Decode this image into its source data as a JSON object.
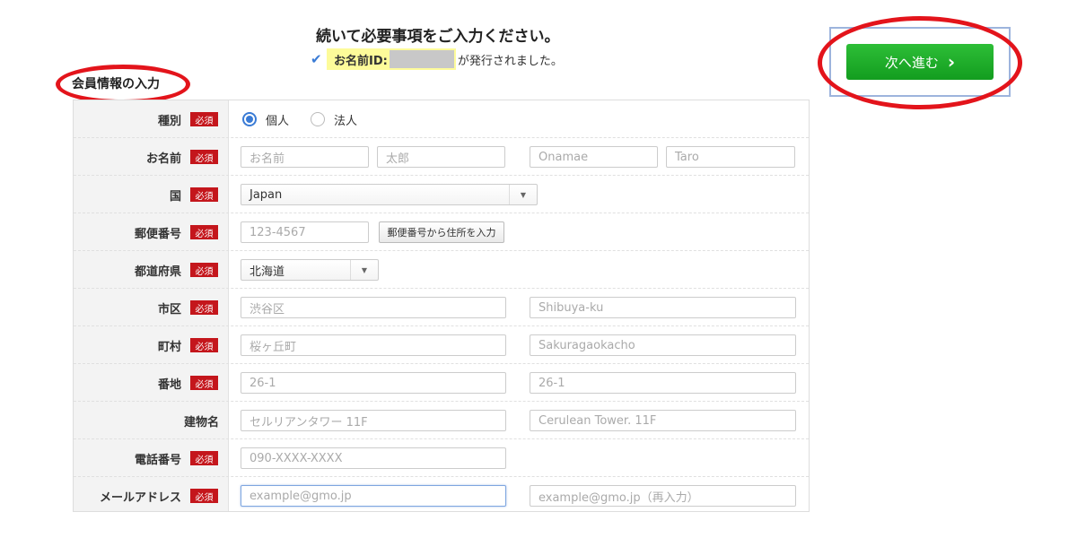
{
  "header": {
    "title": "続いて必要事項をご入力ください。",
    "id_label": "お名前ID:",
    "id_suffix": "が発行されました。"
  },
  "section_title": "会員情報の入力",
  "next_button": {
    "label": "次へ進む"
  },
  "required_badge": "必須",
  "form": {
    "type": {
      "label": "種別",
      "options": [
        "個人",
        "法人"
      ],
      "selected": "個人"
    },
    "name": {
      "label": "お名前",
      "placeholders": [
        "お名前",
        "太郎",
        "Onamae",
        "Taro"
      ]
    },
    "country": {
      "label": "国",
      "value": "Japan"
    },
    "zip": {
      "label": "郵便番号",
      "placeholder": "123-4567",
      "button": "郵便番号から住所を入力"
    },
    "prefecture": {
      "label": "都道府県",
      "value": "北海道"
    },
    "city": {
      "label": "市区",
      "placeholders": [
        "渋谷区",
        "Shibuya-ku"
      ]
    },
    "town": {
      "label": "町村",
      "placeholders": [
        "桜ヶ丘町",
        "Sakuragaokacho"
      ]
    },
    "address": {
      "label": "番地",
      "placeholders": [
        "26-1",
        "26-1"
      ]
    },
    "building": {
      "label": "建物名",
      "placeholders": [
        "セルリアンタワー 11F",
        "Cerulean Tower. 11F"
      ]
    },
    "phone": {
      "label": "電話番号",
      "placeholder": "090-XXXX-XXXX"
    },
    "email": {
      "label": "メールアドレス",
      "placeholders": [
        "example@gmo.jp",
        "example@gmo.jp（再入力）"
      ]
    }
  },
  "colors": {
    "accent_blue": "#3a7bd5",
    "button_green": "#1fae2a",
    "badge_red": "#c4161c",
    "highlight_yellow": "#fdfb9a",
    "annotation_red": "#e3141b"
  }
}
